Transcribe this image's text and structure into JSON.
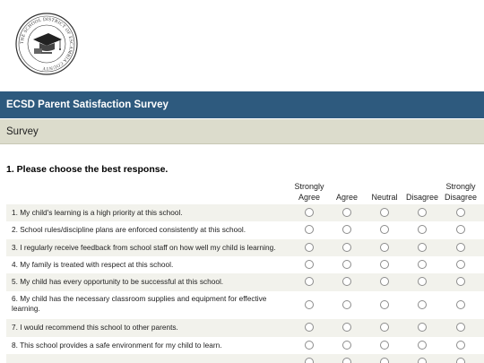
{
  "seal": {
    "text": "THE SCHOOL DISTRICT OF ESCAMBIA COUNTY"
  },
  "header": {
    "title": "ECSD Parent Satisfaction Survey",
    "section": "Survey"
  },
  "question": {
    "label": "1. Please choose the best response.",
    "columns": [
      {
        "line1": "Strongly",
        "line2": "Agree"
      },
      {
        "line1": "",
        "line2": "Agree"
      },
      {
        "line1": "",
        "line2": "Neutral"
      },
      {
        "line1": "",
        "line2": "Disagree"
      },
      {
        "line1": "Strongly",
        "line2": "Disagree"
      }
    ],
    "rows": [
      "1. My child's learning is a high priority at this school.",
      "2. School rules/discipline plans are enforced consistently at this school.",
      "3. I regularly receive feedback from school staff on how well my child is learning.",
      "4. My family is treated with respect at this school.",
      "5. My child has every opportunity to be successful at this school.",
      "6. My child has the necessary classroom supplies and equipment for effective learning.",
      "7. I would recommend this school to other parents.",
      "8. This school provides a safe environment for my child to learn."
    ]
  }
}
